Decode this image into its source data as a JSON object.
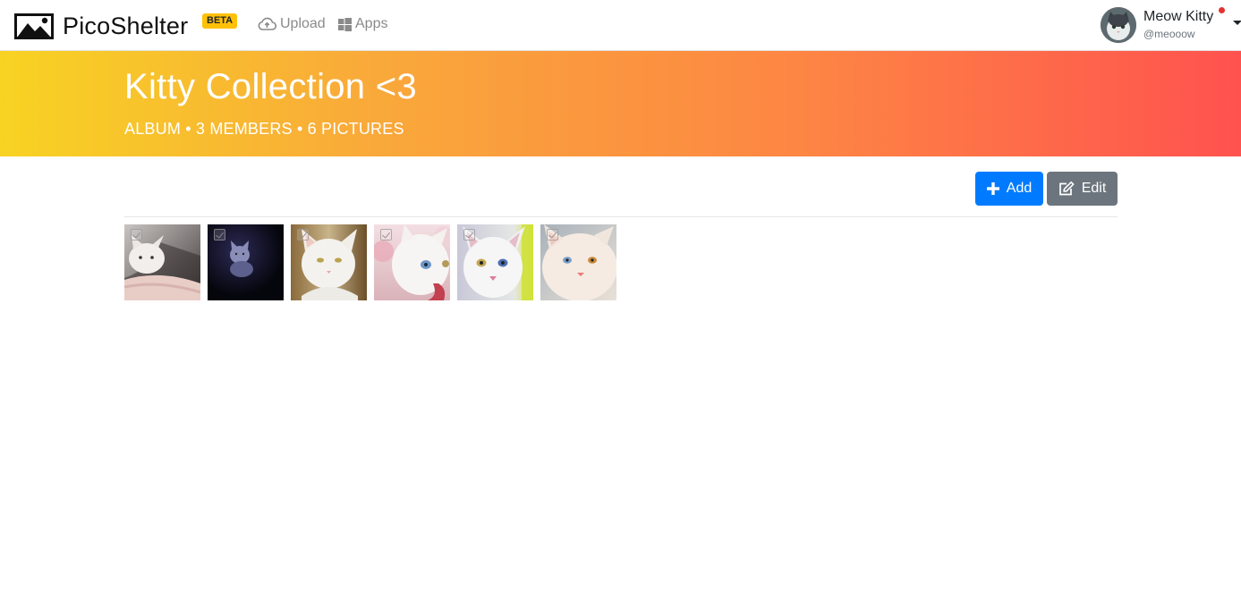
{
  "app": {
    "name": "PicoShelter",
    "badge": "BETA"
  },
  "nav": {
    "upload_label": "Upload",
    "apps_label": "Apps"
  },
  "user": {
    "name": "Meow Kitty",
    "handle": "@meooow"
  },
  "album": {
    "title": "Kitty Collection <3",
    "meta": "ALBUM • 3 MEMBERS • 6 PICTURES"
  },
  "toolbar": {
    "add_label": "Add",
    "edit_label": "Edit"
  },
  "colors": {
    "primary": "#007bff",
    "secondary": "#6c757d",
    "badge": "#ffc107",
    "banner_start": "#f8d323",
    "banner_end": "#ff524f",
    "notification": "#e3342f"
  },
  "pictures": [
    {
      "subject": "white cat on blanket",
      "selected": false
    },
    {
      "subject": "white cat in dark",
      "selected": false
    },
    {
      "subject": "white cat with amber eyes",
      "selected": false
    },
    {
      "subject": "white kitten with blue eye",
      "selected": false
    },
    {
      "subject": "white cat with odd eyes",
      "selected": false
    },
    {
      "subject": "cream cat with odd eyes",
      "selected": false
    }
  ]
}
